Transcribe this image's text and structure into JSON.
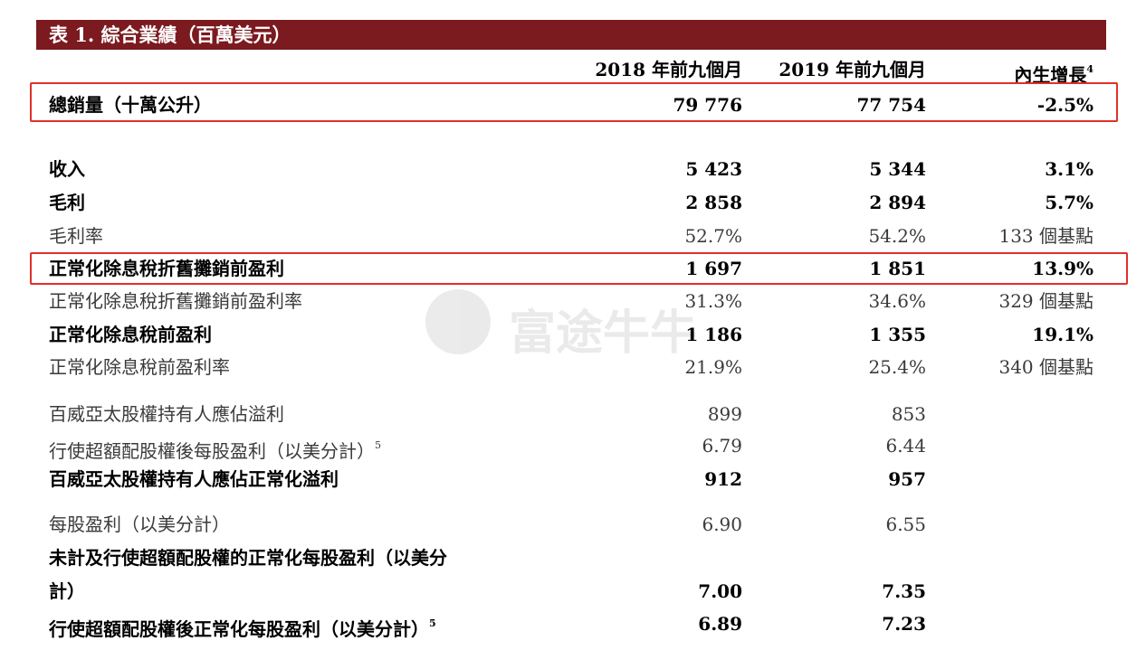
{
  "title": "表 1. 綜合業績（百萬美元）",
  "columns": {
    "col1": "2018 年前九個月",
    "col2": "2019 年前九個月",
    "col3": "內生增長",
    "col3_sup": "4"
  },
  "rows": [
    {
      "label": "總銷量（十萬公升）",
      "v1": "79 776",
      "v2": "77 754",
      "v3": "-2.5%"
    },
    {
      "label": "收入",
      "v1": "5 423",
      "v2": "5 344",
      "v3": "3.1%"
    },
    {
      "label": "毛利",
      "v1": "2 858",
      "v2": "2 894",
      "v3": "5.7%"
    },
    {
      "label": "毛利率",
      "v1": "52.7%",
      "v2": "54.2%",
      "v3": "133 個基點"
    },
    {
      "label": "正常化除息稅折舊攤銷前盈利",
      "v1": "1 697",
      "v2": "1 851",
      "v3": "13.9%"
    },
    {
      "label": "正常化除息稅折舊攤銷前盈利率",
      "v1": "31.3%",
      "v2": "34.6%",
      "v3": "329 個基點"
    },
    {
      "label": "正常化除息稅前盈利",
      "v1": "1 186",
      "v2": "1 355",
      "v3": "19.1%"
    },
    {
      "label": "正常化除息稅前盈利率",
      "v1": "21.9%",
      "v2": "25.4%",
      "v3": "340 個基點"
    },
    {
      "label": "百威亞太股權持有人應佔溢利",
      "v1": "899",
      "v2": "853",
      "v3": ""
    },
    {
      "label": "行使超額配股權後每股盈利（以美分計）",
      "label_sup": "5",
      "v1": "6.79",
      "v2": "6.44",
      "v3": ""
    },
    {
      "label": "百威亞太股權持有人應佔正常化溢利",
      "v1": "912",
      "v2": "957",
      "v3": ""
    },
    {
      "label": "每股盈利（以美分計）",
      "v1": "6.90",
      "v2": "6.55",
      "v3": ""
    },
    {
      "label": "未計及行使超額配股權的正常化每股盈利（以美分",
      "v1": "",
      "v2": "",
      "v3": ""
    },
    {
      "label": "計）",
      "v1": "7.00",
      "v2": "7.35",
      "v3": ""
    },
    {
      "label": "行使超額配股權後正常化每股盈利（以美分計）",
      "label_sup": "5",
      "v1": "6.89",
      "v2": "7.23",
      "v3": ""
    }
  ],
  "watermark": {
    "text": "富途牛牛",
    "icon": "futu-logo-icon"
  },
  "colors": {
    "title_bar": "#7b1a1f",
    "highlight": "#e0302a"
  }
}
